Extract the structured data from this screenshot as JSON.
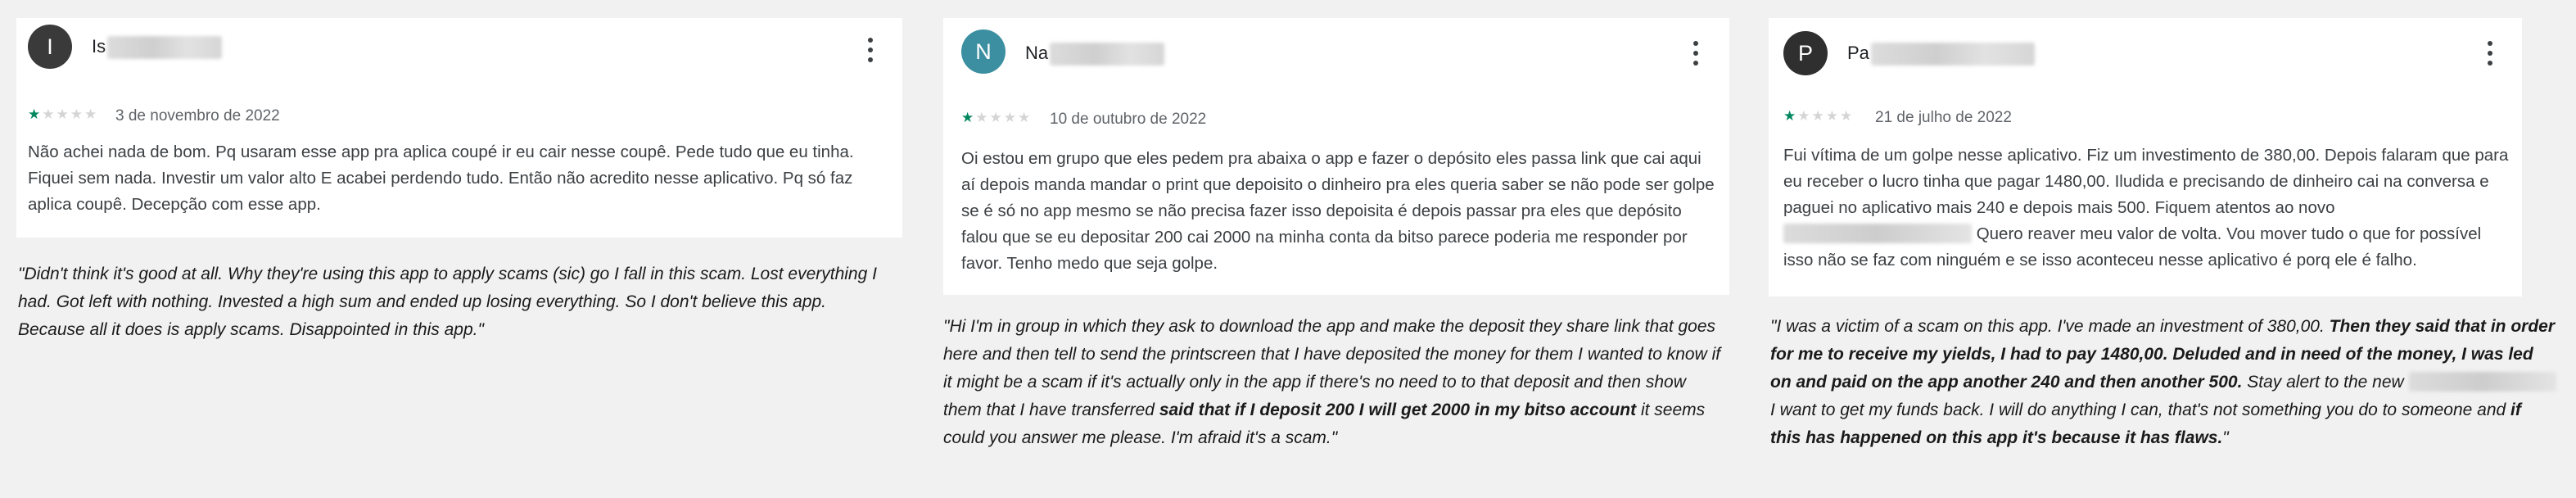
{
  "colors": {
    "page_bg": "#f1f1f1",
    "card_bg": "#ffffff",
    "star_filled": "#01875f",
    "star_empty": "#d5d5d5",
    "avatar_1": "#3a3a3a",
    "avatar_2": "#3b8fa1",
    "avatar_3": "#2f2f2f"
  },
  "reviews": [
    {
      "avatar_letter": "I",
      "name_visible": "Is",
      "menu_icon": "more-vert-icon",
      "rating": 1,
      "rating_max": 5,
      "date": "3 de novembro de 2022",
      "text": "Não achei nada de bom. Pq usaram esse app pra aplica coupé ir eu cair nesse coupê. Pede tudo que eu tinha. Fiquei sem nada. Investir um valor alto E acabei perdendo tudo. Então não acredito nesse aplicativo. Pq só faz aplica coupê. Decepção com esse app.",
      "translation": "\"Didn't think it's good at all. Why they're using this app to apply scams (sic) go I fall in this scam. Lost everything I had. Got left with nothing. Invested a high sum and ended up losing everything. So I don't believe this app. Because all it does is apply scams. Disappointed in this app.\""
    },
    {
      "avatar_letter": "N",
      "name_visible": "Na",
      "menu_icon": "more-vert-icon",
      "rating": 1,
      "rating_max": 5,
      "date": "10 de outubro de 2022",
      "text": "Oi estou em grupo que eles pedem pra abaixa o app e fazer o depósito eles passa link que cai aqui aí depois manda mandar o print que depoisito o dinheiro pra eles queria saber se não pode ser golpe se é só no app mesmo se não precisa fazer isso depoisita é depois passar pra eles que depósito falou que se eu depositar 200 cai 2000 na minha conta da bitso parece poderia me responder por favor. Tenho medo que seja golpe.",
      "translation_part1": "\"Hi I'm in group in which they ask to download the app and make the deposit they share link that goes here and then tell to send the printscreen that I have deposited the money for them I wanted to know if it might be a scam if it's actually only in the app if there's no need to to that deposit and then show them that I have transferred ",
      "translation_bold1": "said that if I deposit 200 I will get 2000 in my bitso account",
      "translation_part2": " it seems could you answer me please. I'm afraid it's a scam.\""
    },
    {
      "avatar_letter": "P",
      "name_visible": "Pa",
      "menu_icon": "more-vert-icon",
      "rating": 1,
      "rating_max": 5,
      "date": "21 de julho de 2022",
      "text_part1": "Fui vítima de um golpe nesse aplicativo. Fiz um investimento de 380,00. Depois falaram que para eu receber o lucro tinha que pagar 1480,00. Iludida e precisando de dinheiro cai na conversa e paguei no aplicativo mais 240 e depois mais 500. Fiquem atentos ao novo",
      "text_part2": " Quero reaver meu valor de volta. Vou mover tudo o que for possível isso não se faz com ninguém e se isso aconteceu nesse aplicativo é porq ele é falho.",
      "translation_part1": "\"I was a victim of a scam on this app. I've made an investment of 380,00. ",
      "translation_bold1": "Then they said that in order for me to receive my yields, I had to pay 1480,00. Deluded and in need of the money, I was led on and paid on the app another 240 and then another 500.",
      "translation_part2": " Stay alert to the new ",
      "translation_part3": " I want to get my funds back. I will do anything I can, that's not something you do to someone and ",
      "translation_bold2": "if this has happened on this app it's because it has flaws.",
      "translation_part4": "\""
    }
  ]
}
